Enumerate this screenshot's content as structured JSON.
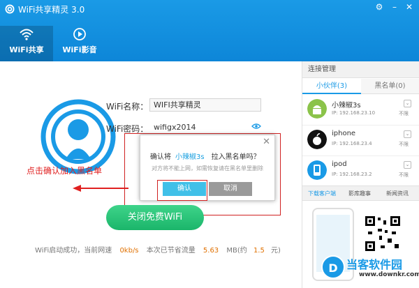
{
  "window": {
    "title": "WiFi共享精灵 3.0",
    "controls": [
      "gear-icon",
      "minimize-icon",
      "close-icon"
    ]
  },
  "nav": {
    "tabs": [
      {
        "label": "WiFi共享",
        "icon": "wifi-icon",
        "active": true
      },
      {
        "label": "WiFi影音",
        "icon": "play-icon",
        "active": false
      }
    ]
  },
  "main": {
    "name_label": "WiFi名称：",
    "name_value": "WIFI共享精灵",
    "password_label": "WiFi密码：",
    "password_value": "wifigx2014",
    "button_label": "关闭免费WiFi",
    "status": {
      "prefix": "WiFi启动成功，当前网速",
      "speed": "0kb/s",
      "saved_label": "本次已节省流量",
      "saved_mb": "5.63",
      "mb_approx": "MB(约",
      "yuan": "1.5",
      "yuan_unit": "元)"
    }
  },
  "annotation": {
    "text": "点击确认加入黑名单"
  },
  "dialog": {
    "q_prefix": "确认将",
    "device_name": "小辣椒3s",
    "q_suffix": "拉入黑名单吗？",
    "subtext": "对方将不能上网，如需恢复请在黑名单里删除",
    "confirm": "确认",
    "cancel": "取消"
  },
  "sidebar": {
    "title": "连接管理",
    "tabs": [
      {
        "label": "小伙伴(3)",
        "active": true
      },
      {
        "label": "黑名单(0)",
        "active": false
      }
    ],
    "devices": [
      {
        "name": "小辣椒3s",
        "ip": "IP: 192.168.23.10",
        "limit": "不限",
        "icon": "android-icon"
      },
      {
        "name": "iphone",
        "ip": "IP: 192.168.23.4",
        "limit": "不限",
        "icon": "apple-icon"
      },
      {
        "name": "ipod",
        "ip": "IP: 192.168.23.2",
        "limit": "不限",
        "icon": "ipod-icon"
      }
    ],
    "promo_tabs": [
      "下载客户端",
      "影库趣事",
      "新闻资讯"
    ]
  },
  "watermark": {
    "text": "当客软件园",
    "url": "www.downkr.com"
  },
  "colors": {
    "brand_blue": "#1a9ae6",
    "green_button": "#1bb56a",
    "annotation_red": "#e02020"
  }
}
